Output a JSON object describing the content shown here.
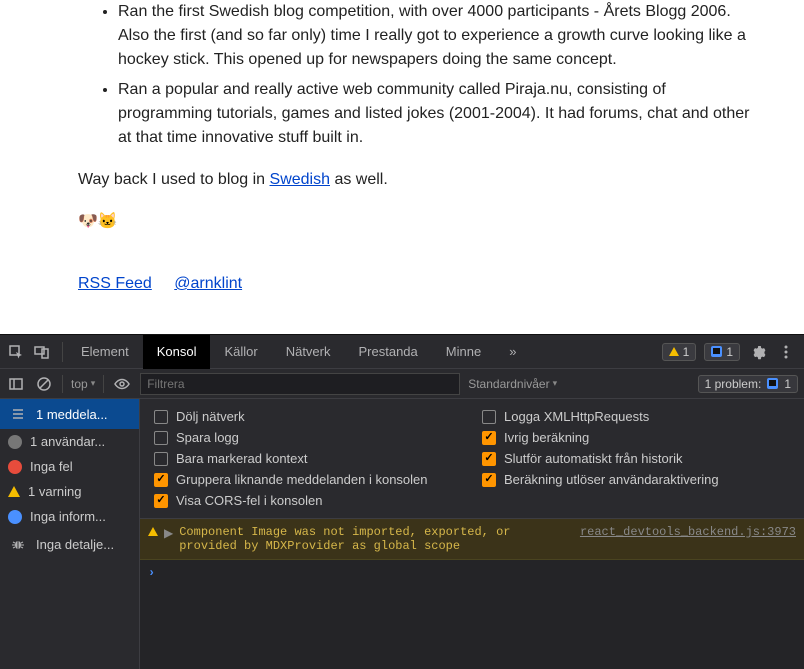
{
  "page": {
    "bullets": [
      "Ran the first Swedish blog competition, with over 4000 participants - Årets Blogg 2006. Also the first (and so far only) time I really got to experience a growth curve looking like a hockey stick. This opened up for newspapers doing the same concept.",
      "Ran a popular and really active web community called Piraja.nu, consisting of programming tutorials, games and listed jokes (2001-2004). It had forums, chat and other at that time innovative stuff built in."
    ],
    "p_before": "Way back I used to blog in ",
    "link_swedish": "Swedish",
    "p_after": " as well.",
    "emoji": "🐶🐱",
    "rss": "RSS Feed",
    "twitter": "@arnklint"
  },
  "devtools": {
    "tabs": [
      "Element",
      "Konsol",
      "Källor",
      "Nätverk",
      "Prestanda",
      "Minne"
    ],
    "more": "»",
    "warn_count": "1",
    "msg_count": "1",
    "filterbar": {
      "top": "top",
      "caret": "▾",
      "filter_placeholder": "Filtrera",
      "levels": "Standardnivåer",
      "problem": "1 problem:",
      "problem_count": "1"
    },
    "sidebar": [
      {
        "icon": "list",
        "label": "1 meddela..."
      },
      {
        "icon": "person",
        "label": "1 användar..."
      },
      {
        "icon": "red",
        "label": "Inga fel"
      },
      {
        "icon": "warn",
        "label": "1 varning"
      },
      {
        "icon": "info",
        "label": "Inga inform..."
      },
      {
        "icon": "bug",
        "label": "Inga detalje..."
      }
    ],
    "settings": {
      "left": [
        {
          "checked": false,
          "label": "Dölj nätverk"
        },
        {
          "checked": false,
          "label": "Spara logg"
        },
        {
          "checked": false,
          "label": "Bara markerad kontext"
        },
        {
          "checked": true,
          "label": "Gruppera liknande meddelanden i konsolen"
        },
        {
          "checked": true,
          "label": "Visa CORS-fel i konsolen"
        }
      ],
      "right": [
        {
          "checked": false,
          "label": "Logga XMLHttpRequests"
        },
        {
          "checked": true,
          "label": "Ivrig beräkning"
        },
        {
          "checked": true,
          "label": "Slutför automatiskt från historik"
        },
        {
          "checked": true,
          "label": "Beräkning utlöser användaraktivering"
        }
      ]
    },
    "console": {
      "warn_msg": "Component Image was not imported, exported, or provided by MDXProvider as global scope",
      "warn_src": "react_devtools_backend.js:3973"
    }
  }
}
